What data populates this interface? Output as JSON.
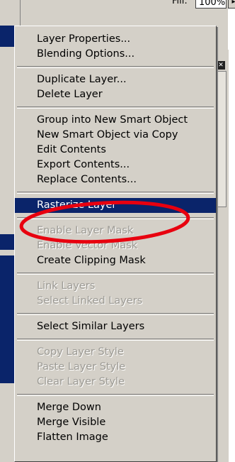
{
  "fill": {
    "label": "Fill:",
    "value": "100%",
    "arrow": "▸"
  },
  "panel_icon": "✕",
  "menu": {
    "groups": [
      {
        "items": [
          {
            "label": "Layer Properties...",
            "enabled": true
          },
          {
            "label": "Blending Options...",
            "enabled": true
          }
        ]
      },
      {
        "items": [
          {
            "label": "Duplicate Layer...",
            "enabled": true
          },
          {
            "label": "Delete Layer",
            "enabled": true
          }
        ]
      },
      {
        "items": [
          {
            "label": "Group into New Smart Object",
            "enabled": true
          },
          {
            "label": "New Smart Object via Copy",
            "enabled": true
          },
          {
            "label": "Edit Contents",
            "enabled": true
          },
          {
            "label": "Export Contents...",
            "enabled": true
          },
          {
            "label": "Replace Contents...",
            "enabled": true
          }
        ]
      },
      {
        "items": [
          {
            "label": "Rasterize Layer",
            "enabled": true,
            "selected": true
          }
        ]
      },
      {
        "items": [
          {
            "label": "Enable Layer Mask",
            "enabled": false
          },
          {
            "label": "Enable Vector Mask",
            "enabled": false
          },
          {
            "label": "Create Clipping Mask",
            "enabled": true
          }
        ]
      },
      {
        "items": [
          {
            "label": "Link Layers",
            "enabled": false
          },
          {
            "label": "Select Linked Layers",
            "enabled": false
          }
        ]
      },
      {
        "items": [
          {
            "label": "Select Similar Layers",
            "enabled": true
          }
        ]
      },
      {
        "items": [
          {
            "label": "Copy Layer Style",
            "enabled": false
          },
          {
            "label": "Paste Layer Style",
            "enabled": false
          },
          {
            "label": "Clear Layer Style",
            "enabled": false
          }
        ]
      },
      {
        "items": [
          {
            "label": "Merge Down",
            "enabled": true
          },
          {
            "label": "Merge Visible",
            "enabled": true
          },
          {
            "label": "Flatten Image",
            "enabled": true
          }
        ]
      }
    ]
  },
  "colors": {
    "menu_bg": "#d4d0c8",
    "selection": "#0a246a",
    "disabled_text": "#9c9a94",
    "highlight_ellipse": "#e8000f"
  }
}
